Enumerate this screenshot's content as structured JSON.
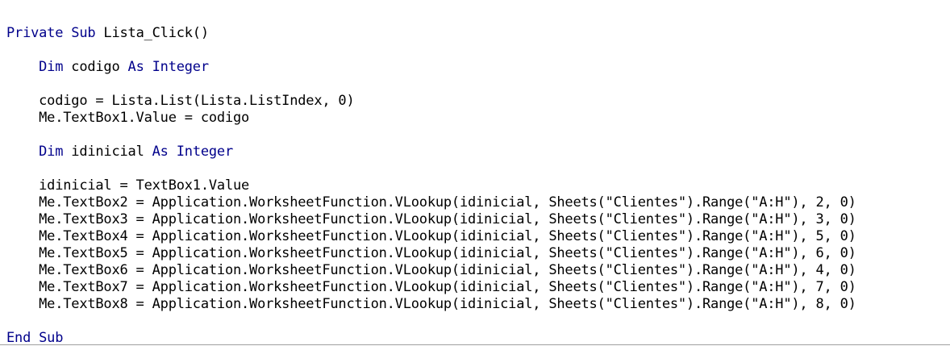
{
  "code_lines": [
    [
      {
        "t": "Private Sub",
        "k": true
      },
      {
        "t": " Lista_Click()",
        "k": false
      }
    ],
    [],
    [
      {
        "t": "    ",
        "k": false
      },
      {
        "t": "Dim",
        "k": true
      },
      {
        "t": " codigo ",
        "k": false
      },
      {
        "t": "As Integer",
        "k": true
      }
    ],
    [],
    [
      {
        "t": "    codigo = Lista.List(Lista.ListIndex, 0)",
        "k": false
      }
    ],
    [
      {
        "t": "    Me.TextBox1.Value = codigo",
        "k": false
      }
    ],
    [],
    [
      {
        "t": "    ",
        "k": false
      },
      {
        "t": "Dim",
        "k": true
      },
      {
        "t": " idinicial ",
        "k": false
      },
      {
        "t": "As Integer",
        "k": true
      }
    ],
    [],
    [
      {
        "t": "    idinicial = TextBox1.Value",
        "k": false
      }
    ],
    [
      {
        "t": "    Me.TextBox2 = Application.WorksheetFunction.VLookup(idinicial, Sheets(\"Clientes\").Range(\"A:H\"), 2, 0)",
        "k": false
      }
    ],
    [
      {
        "t": "    Me.TextBox3 = Application.WorksheetFunction.VLookup(idinicial, Sheets(\"Clientes\").Range(\"A:H\"), 3, 0)",
        "k": false
      }
    ],
    [
      {
        "t": "    Me.TextBox4 = Application.WorksheetFunction.VLookup(idinicial, Sheets(\"Clientes\").Range(\"A:H\"), 5, 0)",
        "k": false
      }
    ],
    [
      {
        "t": "    Me.TextBox5 = Application.WorksheetFunction.VLookup(idinicial, Sheets(\"Clientes\").Range(\"A:H\"), 6, 0)",
        "k": false
      }
    ],
    [
      {
        "t": "    Me.TextBox6 = Application.WorksheetFunction.VLookup(idinicial, Sheets(\"Clientes\").Range(\"A:H\"), 4, 0)",
        "k": false
      }
    ],
    [
      {
        "t": "    Me.TextBox7 = Application.WorksheetFunction.VLookup(idinicial, Sheets(\"Clientes\").Range(\"A:H\"), 7, 0)",
        "k": false
      }
    ],
    [
      {
        "t": "    Me.TextBox8 = Application.WorksheetFunction.VLookup(idinicial, Sheets(\"Clientes\").Range(\"A:H\"), 8, 0)",
        "k": false
      }
    ],
    [],
    [
      {
        "t": "End Sub",
        "k": true
      }
    ]
  ],
  "colors": {
    "keyword": "#00008b",
    "text": "#000000",
    "background": "#ffffff"
  }
}
